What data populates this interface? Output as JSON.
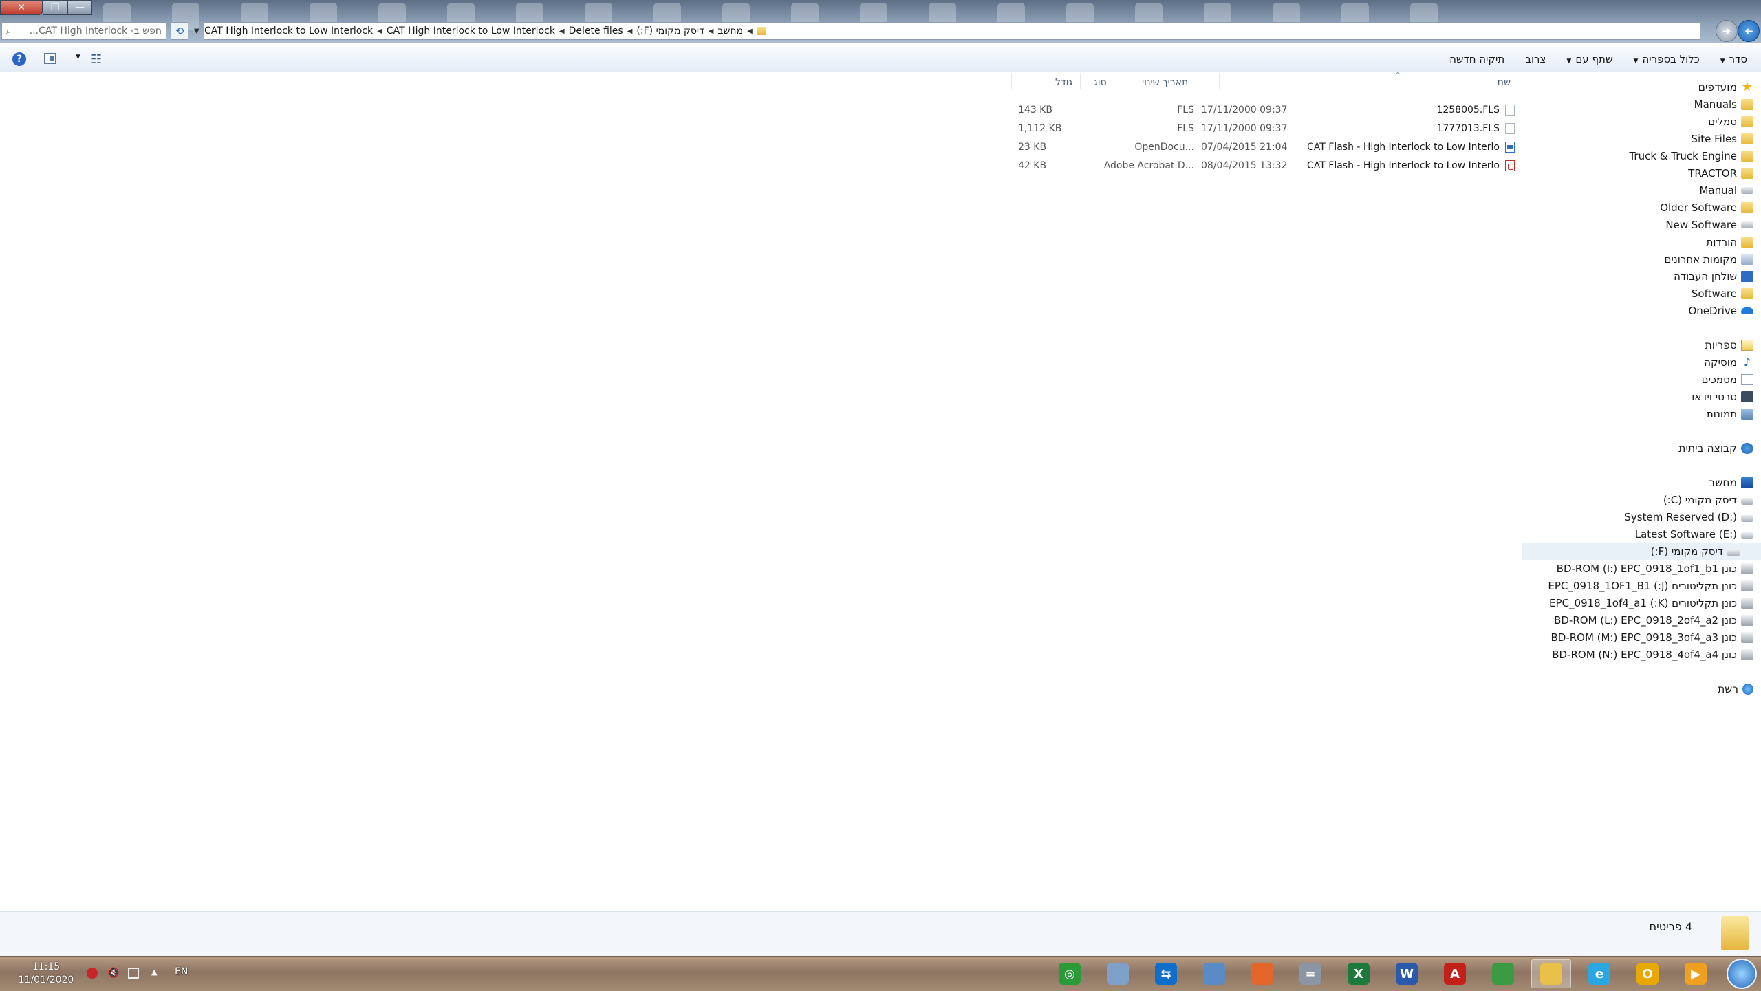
{
  "window": {
    "buttons": {
      "close": "✕",
      "maximize": "❐",
      "minimize": "—"
    }
  },
  "search": {
    "placeholder": "חפש ב- CAT High Interlock..."
  },
  "address": {
    "crumbs": [
      "מחשב",
      "דיסק מקומי (F:)",
      "Delete files",
      "CAT High Interlock to Low Interlock",
      "CAT High Interlock to Low Interlock"
    ]
  },
  "toolbar": {
    "organize": "סדר",
    "include_in_library": "כלול בספריה",
    "share_with": "שתף עם",
    "burn": "צרוב",
    "new_folder": "תיקיה חדשה",
    "help": "?"
  },
  "nav": {
    "favorites": [
      {
        "label": "מועדפים",
        "icon": "star-icon"
      },
      {
        "label": "Manuals",
        "icon": "folder-icon"
      },
      {
        "label": "סמלים",
        "icon": "folder-icon"
      },
      {
        "label": "Site Files",
        "icon": "folder-icon"
      },
      {
        "label": "Truck & Truck Engine",
        "icon": "folder-icon"
      },
      {
        "label": "TRACTOR",
        "icon": "folder-icon"
      },
      {
        "label": "Manual",
        "icon": "network-drive-icon"
      },
      {
        "label": "Older Software",
        "icon": "folder-icon"
      },
      {
        "label": "New Software",
        "icon": "network-drive-icon"
      },
      {
        "label": "הורדות",
        "icon": "downloads-icon"
      },
      {
        "label": "מקומות אחרונים",
        "icon": "recent-places-icon"
      },
      {
        "label": "שולחן העבודה",
        "icon": "desktop-icon"
      },
      {
        "label": "Software",
        "icon": "folder-icon"
      },
      {
        "label": "OneDrive",
        "icon": "cloud-icon"
      }
    ],
    "libraries": [
      {
        "label": "ספריות",
        "icon": "library-icon"
      },
      {
        "label": "מוסיקה",
        "icon": "music-icon"
      },
      {
        "label": "מסמכים",
        "icon": "documents-icon"
      },
      {
        "label": "סרטי וידאו",
        "icon": "video-icon"
      },
      {
        "label": "תמונות",
        "icon": "pictures-icon"
      }
    ],
    "homegroup": "קבוצה ביתית",
    "computer": [
      {
        "label": "מחשב",
        "icon": "computer-icon"
      },
      {
        "label": "דיסק מקומי (C:)",
        "icon": "drive-icon"
      },
      {
        "label": "System Reserved (D:)",
        "icon": "drive-icon"
      },
      {
        "label": "Latest Software (E:)",
        "icon": "drive-icon"
      },
      {
        "label": "דיסק מקומי (F:)",
        "icon": "drive-icon",
        "selected": true
      },
      {
        "label": "כונן BD-ROM (I:) EPC_0918_1of1_b1",
        "icon": "bdrom-icon"
      },
      {
        "label": "כונן תקליטורים (J:) EPC_0918_1OF1_B1",
        "icon": "cd-drive-icon"
      },
      {
        "label": "כונן תקליטורים (K:) EPC_0918_1of4_a1",
        "icon": "cd-drive-icon"
      },
      {
        "label": "כונן BD-ROM (L:) EPC_0918_2of4_a2",
        "icon": "bdrom-icon"
      },
      {
        "label": "כונן BD-ROM (M:) EPC_0918_3of4_a3",
        "icon": "bdrom-icon"
      },
      {
        "label": "כונן BD-ROM (N:) EPC_0918_4of4_a4",
        "icon": "bdrom-icon"
      }
    ],
    "network": "רשת"
  },
  "columns": {
    "name": "שם",
    "date": "תאריך שינוי",
    "type": "סוג",
    "size": "גודל"
  },
  "files": [
    {
      "name": "1258005.FLS",
      "date": "17/11/2000 09:37",
      "type": "FLS",
      "size": "143 KB",
      "icon": "generic-file-icon"
    },
    {
      "name": "1777013.FLS",
      "date": "17/11/2000 09:37",
      "type": "FLS",
      "size": "1,112 KB",
      "icon": "generic-file-icon"
    },
    {
      "name": "CAT Flash - High Interlock to Low Interlo...",
      "date": "07/04/2015 21:04",
      "type": "OpenDocu...",
      "size": "23 KB",
      "icon": "document-file-icon"
    },
    {
      "name": "CAT Flash - High Interlock to Low Interlo...",
      "date": "08/04/2015 13:32",
      "type": "Adobe Acrobat D...",
      "size": "42 KB",
      "icon": "pdf-file-icon"
    }
  ],
  "details": {
    "count": "4 פריטים"
  },
  "taskbar": {
    "time": "11:15",
    "date": "11/01/2020",
    "language": "EN",
    "apps": [
      {
        "name": "windows-media-player-icon",
        "glyph": "▶",
        "color": "#f0a020"
      },
      {
        "name": "outlook-icon",
        "glyph": "O",
        "color": "#e8a800"
      },
      {
        "name": "ie-edge-icon",
        "glyph": "e",
        "color": "#2aa7e0"
      },
      {
        "name": "explorer-icon",
        "glyph": "",
        "color": "#e8c04a"
      },
      {
        "name": "chrome-icon",
        "glyph": "",
        "color": "#3b9a44"
      },
      {
        "name": "adobe-reader-icon",
        "glyph": "A",
        "color": "#c4201a"
      },
      {
        "name": "word-icon",
        "glyph": "W",
        "color": "#2b5aad"
      },
      {
        "name": "excel-icon",
        "glyph": "X",
        "color": "#1d7a3c"
      },
      {
        "name": "calculator-icon",
        "glyph": "=",
        "color": "#8a96a6"
      },
      {
        "name": "firefox-icon",
        "glyph": "",
        "color": "#e2662a"
      },
      {
        "name": "remote-desktop-icon",
        "glyph": "",
        "color": "#5a8bc4"
      },
      {
        "name": "teamviewer-icon",
        "glyph": "⇆",
        "color": "#0e6ec9"
      },
      {
        "name": "notepad-icon",
        "glyph": "",
        "color": "#7fa0c8"
      },
      {
        "name": "green-app-icon",
        "glyph": "◎",
        "color": "#2b9b3a"
      }
    ]
  },
  "colors": {
    "accent": "#2a64c6",
    "selection": "#e8f0f8"
  }
}
